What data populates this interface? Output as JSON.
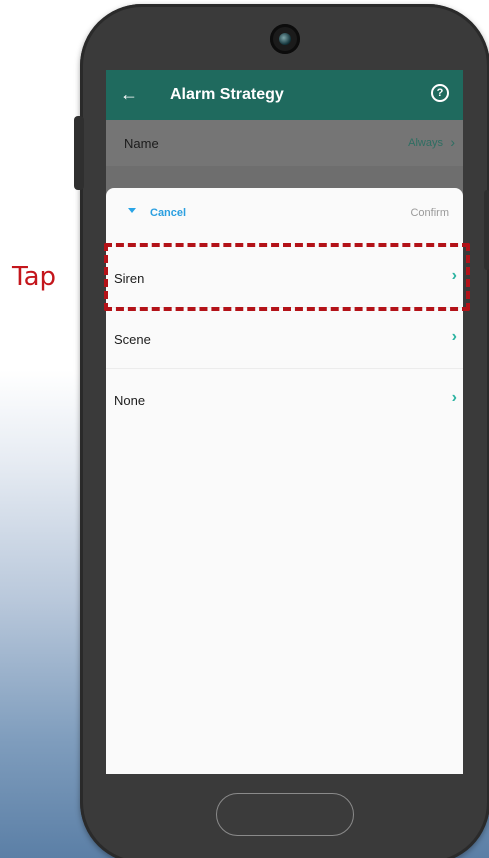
{
  "app_bar": {
    "back_icon": "←",
    "title": "Alarm Strategy",
    "help_icon": "?"
  },
  "name_row": {
    "label": "Name",
    "value": "Always",
    "chevron": "›"
  },
  "sheet": {
    "cancel_label": "Cancel",
    "confirm_label": "Confirm",
    "options": [
      {
        "label": "Siren",
        "chevron": "›"
      },
      {
        "label": "Scene",
        "chevron": "›"
      },
      {
        "label": "None",
        "chevron": "›"
      }
    ]
  },
  "annotation": {
    "tap_label": "Tap"
  },
  "colors": {
    "app_bar": "#1f6a5e",
    "accent_blue": "#2b9fe0",
    "chevron_teal": "#2bb3a0",
    "tap_red": "#c4161c"
  }
}
